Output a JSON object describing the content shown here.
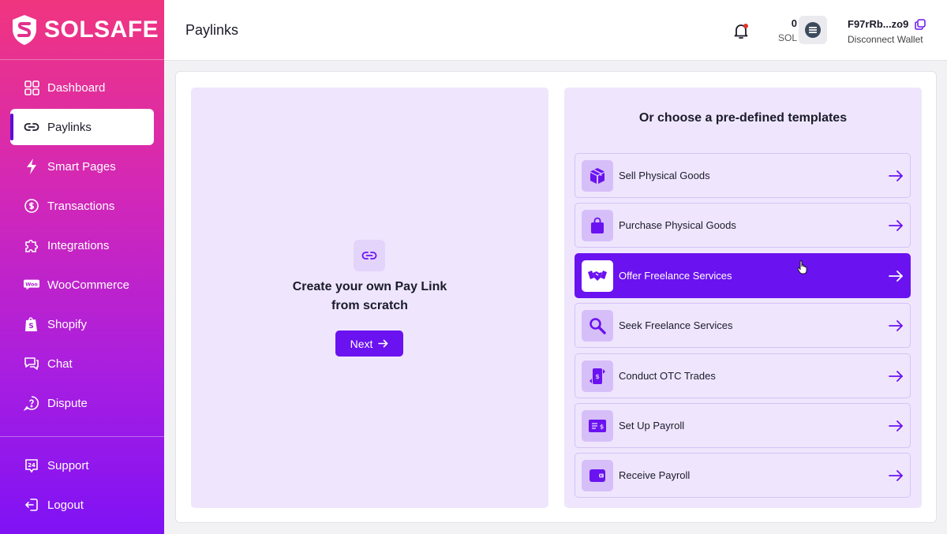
{
  "brand": {
    "name": "SOLSAFE"
  },
  "sidebar": {
    "items": [
      {
        "label": "Dashboard",
        "icon": "grid-icon"
      },
      {
        "label": "Paylinks",
        "icon": "link-icon",
        "active": true
      },
      {
        "label": "Smart Pages",
        "icon": "lightning-icon"
      },
      {
        "label": "Transactions",
        "icon": "coin-cycle-icon"
      },
      {
        "label": "Integrations",
        "icon": "puzzle-icon"
      },
      {
        "label": "WooCommerce",
        "icon": "woo-icon"
      },
      {
        "label": "Shopify",
        "icon": "shopify-bag-icon"
      },
      {
        "label": "Chat",
        "icon": "chat-icon"
      },
      {
        "label": "Dispute",
        "icon": "question-bubble-icon"
      }
    ],
    "bottom": [
      {
        "label": "Support",
        "icon": "support-24-icon"
      },
      {
        "label": "Logout",
        "icon": "logout-icon"
      }
    ]
  },
  "header": {
    "title": "Paylinks",
    "balance": {
      "amount": "0",
      "unit": "SOL"
    },
    "wallet": {
      "address": "F97rRb...zo9",
      "disconnect_label": "Disconnect Wallet"
    },
    "notification_dot": true
  },
  "create": {
    "line1": "Create your own Pay Link",
    "line2": "from scratch",
    "next_label": "Next"
  },
  "templates": {
    "title": "Or choose a pre-defined templates",
    "items": [
      {
        "label": "Sell Physical Goods",
        "icon": "box-icon"
      },
      {
        "label": "Purchase Physical Goods",
        "icon": "shopping-bag-icon"
      },
      {
        "label": "Offer Freelance Services",
        "icon": "handshake-icon",
        "selected": true
      },
      {
        "label": "Seek Freelance Services",
        "icon": "magnifier-icon"
      },
      {
        "label": "Conduct OTC Trades",
        "icon": "otc-phone-icon"
      },
      {
        "label": "Set Up Payroll",
        "icon": "payroll-card-icon"
      },
      {
        "label": "Receive Payroll",
        "icon": "wallet-icon"
      }
    ]
  },
  "colors": {
    "accent": "#6b12f0",
    "panel": "#efe6fd",
    "sidebar_top": "#f0357f",
    "sidebar_bottom": "#7f12f5"
  }
}
